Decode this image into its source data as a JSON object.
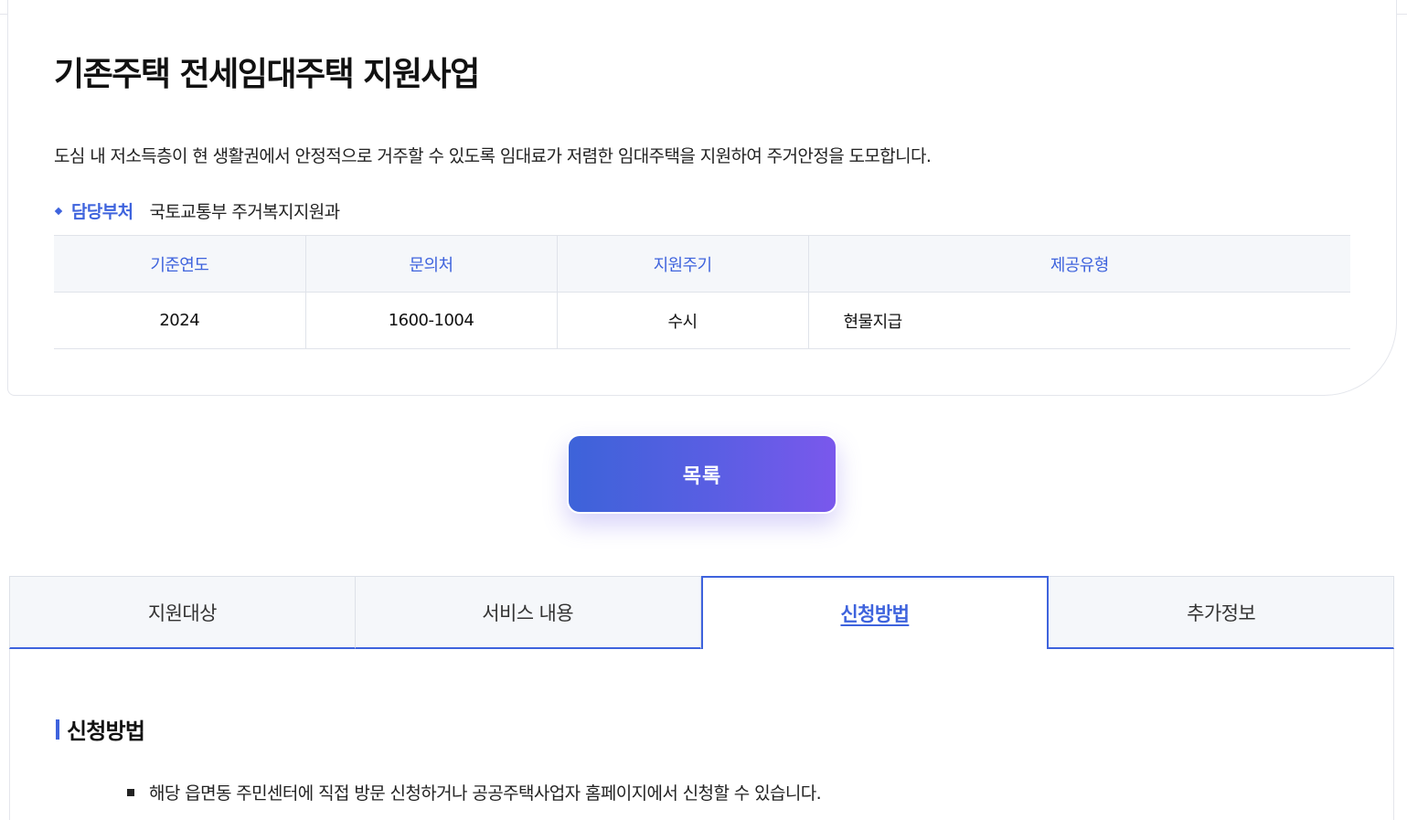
{
  "program": {
    "title": "기존주택 전세임대주택 지원사업",
    "description": "도심 내 저소득층이 현 생활권에서 안정적으로 거주할 수 있도록 임대료가 저렴한 임대주택을 지원하여 주거안정을 도모합니다.",
    "department_label": "담당부처",
    "department_value": "국토교통부 주거복지지원과"
  },
  "info_table": {
    "headers": [
      "기준연도",
      "문의처",
      "지원주기",
      "제공유형"
    ],
    "row": [
      "2024",
      "1600-1004",
      "수시",
      "현물지급"
    ]
  },
  "list_button": {
    "label": "목록"
  },
  "tabs": [
    {
      "label": "지원대상",
      "active": false
    },
    {
      "label": "서비스 내용",
      "active": false
    },
    {
      "label": "신청방법",
      "active": true
    },
    {
      "label": "추가정보",
      "active": false
    }
  ],
  "section": {
    "title": "신청방법",
    "items": [
      "해당 읍면동 주민센터에 직접 방문 신청하거나 공공주택사업자 홈페이지에서 신청할 수 있습니다."
    ]
  },
  "colors": {
    "accent": "#3e63dd",
    "header_bg": "#f5f7fa",
    "button_gradient_end": "#7a58ec"
  }
}
